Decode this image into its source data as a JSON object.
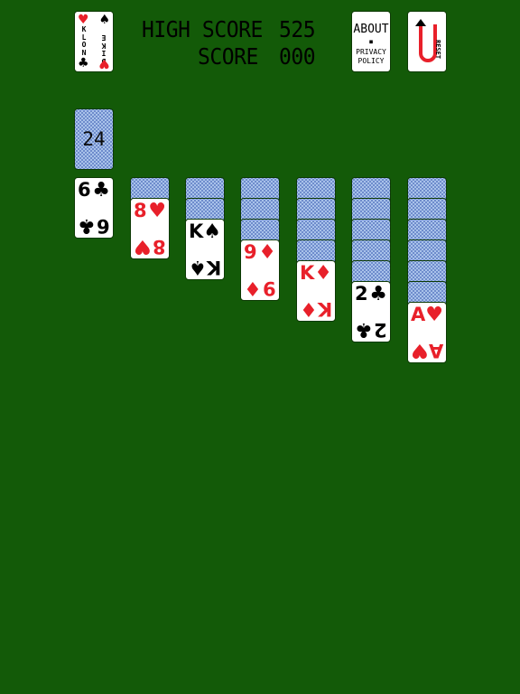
{
  "header": {
    "high_score_label": "HIGH SCORE",
    "high_score_value": "525",
    "score_label": "SCORE",
    "score_value": "000"
  },
  "logo": {
    "left_letters": [
      "K",
      "L",
      "O",
      "N"
    ],
    "right_letters": [
      "D",
      "I",
      "K",
      "E"
    ],
    "top_suit": "♥",
    "bottom_suit": "♣",
    "right_top_suit": "♠",
    "right_bottom_suit": "♥"
  },
  "buttons": {
    "about_line1": "ABOUT",
    "about_bullet": "■",
    "about_line2": "PRIVACY",
    "about_line3": "POLICY",
    "reset_label": "RESET",
    "reset_arrow": "↺"
  },
  "stock": {
    "count": "24"
  },
  "waste": {
    "rank": "6",
    "suit": "♣",
    "color": "black"
  },
  "tableau": [
    {
      "hidden": 1,
      "rank": "8",
      "suit": "♥",
      "color": "red"
    },
    {
      "hidden": 2,
      "rank": "K",
      "suit": "♠",
      "color": "black"
    },
    {
      "hidden": 3,
      "rank": "9",
      "suit": "♦",
      "color": "red"
    },
    {
      "hidden": 4,
      "rank": "K",
      "suit": "♦",
      "color": "red"
    },
    {
      "hidden": 5,
      "rank": "2",
      "suit": "♣",
      "color": "black"
    },
    {
      "hidden": 6,
      "rank": "A",
      "suit": "♥",
      "color": "red"
    }
  ],
  "colors": {
    "felt": "#135a08",
    "card_back": "#a9c2ea",
    "red_suit": "#e8202a",
    "black_suit": "#000000"
  }
}
